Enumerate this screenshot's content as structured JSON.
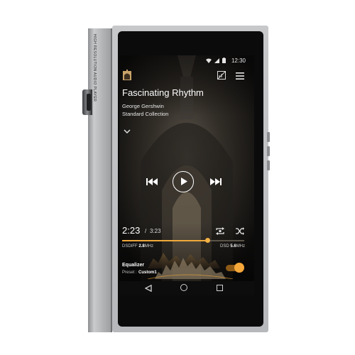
{
  "device": {
    "side_text": "HIGH RESOLUTION AUDIO PLAYER"
  },
  "status_bar": {
    "time": "12:30",
    "icons": [
      "wifi-icon",
      "signal-icon",
      "battery-icon"
    ]
  },
  "top_bar": {
    "icons": [
      "library-icon",
      "eq-off-icon",
      "menu-icon"
    ]
  },
  "now_playing": {
    "title": "Fascinating Rhythm",
    "artist": "George Gershwin",
    "album": "Standard Collection"
  },
  "playback": {
    "current_time": "2:23",
    "separator": "/",
    "total_time": "3:23",
    "progress": 0.7,
    "controls": [
      "prev-icon",
      "play-icon",
      "next-icon"
    ]
  },
  "format": {
    "left_prefix": "DSDIFF",
    "left_value": "2.8",
    "left_unit": "MHz",
    "right_prefix": "DSD",
    "right_value": "5.6",
    "right_unit": "MHz"
  },
  "equalizer": {
    "label": "Equalizer",
    "preset_label": "Preset :",
    "preset_value": "Custom1",
    "enabled": true
  },
  "colors": {
    "accent": "#f0a93a",
    "screen_bg": "#141312",
    "device_silver": "#b8babd"
  }
}
